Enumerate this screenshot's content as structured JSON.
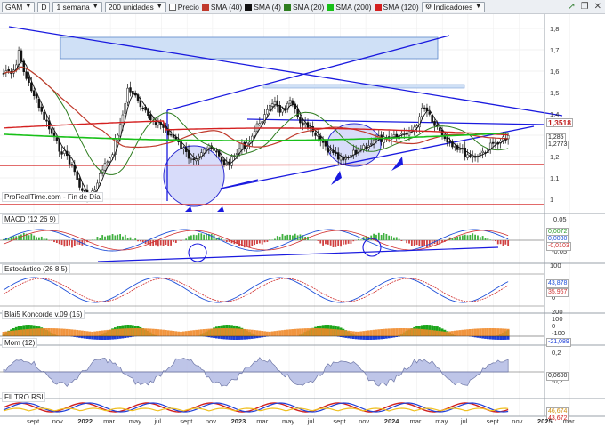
{
  "toolbar": {
    "symbol": "GAM",
    "symbol_badge": "D",
    "period": "1 semana",
    "units": "200 unidades",
    "price_label": "Precio",
    "sma40": "SMA (40)",
    "sma4": "SMA (4)",
    "sma20": "SMA (20)",
    "sma200": "SMA (200)",
    "sma120": "SMA (120)",
    "indicators": "Indicadores"
  },
  "colors": {
    "sma40": "#c0392b",
    "sma4": "#111111",
    "sma20": "#2e7d1f",
    "sma200": "#18c018",
    "sma120": "#d42020",
    "trend": "#1a1adf"
  },
  "price_axis": [
    "1,8",
    "1,7",
    "1,6",
    "1,5",
    "1,4",
    "1,3",
    "1,2",
    "1,1",
    "1"
  ],
  "price_tags": {
    "last": "1,3518",
    "a": "1,285",
    "b": "1,2773"
  },
  "source": "ProRealTime.com - Fin de Día",
  "panels": {
    "macd": {
      "title": "MACD (12 26 9)",
      "vals": [
        "0,0072",
        "0,0030",
        "-0,0103"
      ],
      "ticks": [
        "0,05",
        "-0,05"
      ]
    },
    "stoch": {
      "title": "Estocástico (26 8 5)",
      "vals": [
        "43,878",
        "35,967"
      ],
      "ticks": [
        "100",
        "0"
      ]
    },
    "koncorde": {
      "title": "Blai5 Koncorde v.09 (15)",
      "vals": [
        "-21,089"
      ],
      "ticks": [
        "200",
        "100",
        "0",
        "-100"
      ]
    },
    "mom": {
      "title": "Mom (12)",
      "vals": [
        "0,0600"
      ],
      "ticks": [
        "0,2",
        "-0,2"
      ]
    },
    "rsi": {
      "title": "FILTRO RSI",
      "vals": [
        "46,674",
        "43,672"
      ]
    }
  },
  "time_axis": [
    "sept",
    "nov",
    "2022",
    "mar",
    "may",
    "jul",
    "sept",
    "nov",
    "2023",
    "mar",
    "may",
    "jul",
    "sept",
    "nov",
    "2024",
    "mar",
    "may",
    "jul",
    "sept",
    "nov",
    "2025",
    "mar"
  ],
  "time_axis_bold": [
    "2022",
    "2023",
    "2024",
    "2025"
  ]
}
